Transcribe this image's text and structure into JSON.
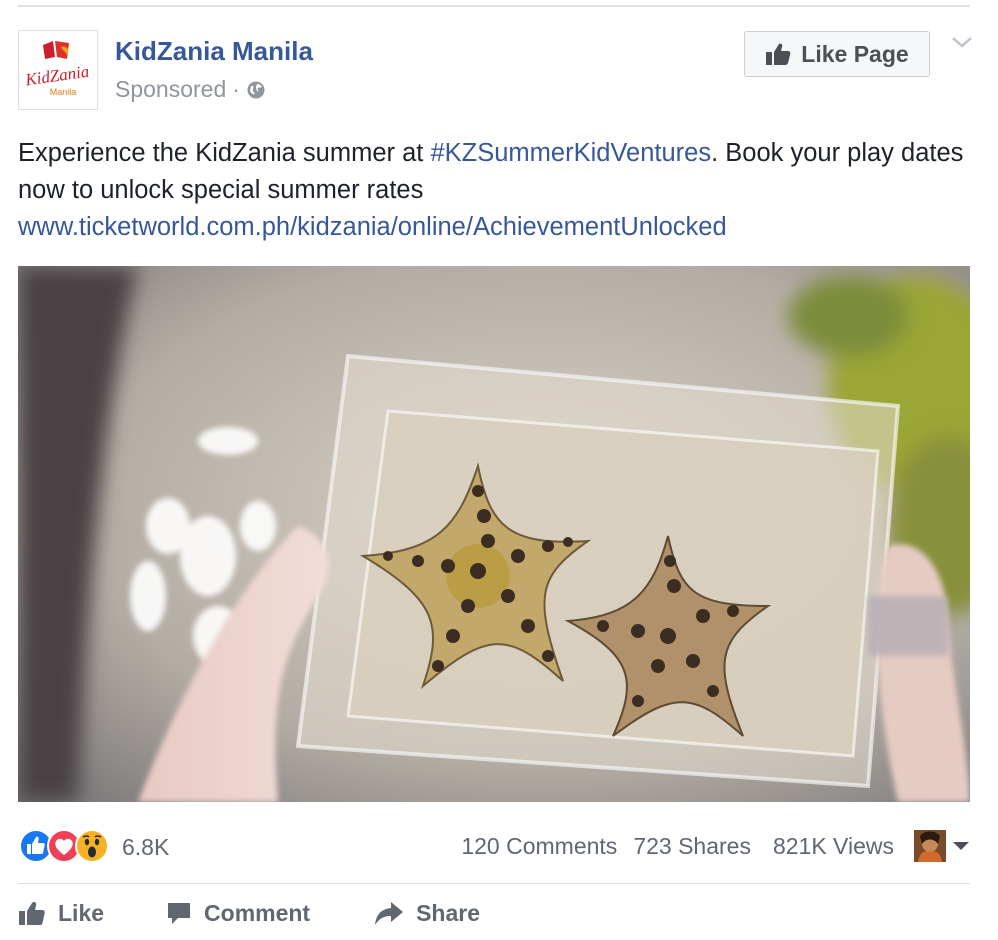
{
  "post": {
    "page_name": "KidZania Manila",
    "sponsored": "Sponsored",
    "dot": "·",
    "logo_text": "KidZania",
    "logo_sub": "Manila",
    "like_page_label": "Like Page",
    "text_before": "Experience the KidZania summer at ",
    "hashtag": "#KZSummerKidVentures",
    "text_after": ". Book your play dates now to unlock special summer rates",
    "link": "www.ticketworld.com.ph/kidzania/online/AchievementUnlocked"
  },
  "stats": {
    "reaction_count": "6.8K",
    "comments": "120 Comments",
    "shares": "723 Shares",
    "views": "821K Views"
  },
  "actions": {
    "like": "Like",
    "comment": "Comment",
    "share": "Share"
  },
  "icons": [
    "logo",
    "globe-icon",
    "thumbs-up-icon",
    "chevron-down-icon",
    "like-reaction-icon",
    "love-reaction-icon",
    "wow-reaction-icon",
    "comment-icon",
    "share-icon",
    "caret-down-icon"
  ],
  "colors": {
    "link": "#365899",
    "text": "#1d2129",
    "muted": "#90949c",
    "like_blue": "#1877f2",
    "love_red": "#f33e58",
    "wow_yellow": "#f7b125"
  }
}
